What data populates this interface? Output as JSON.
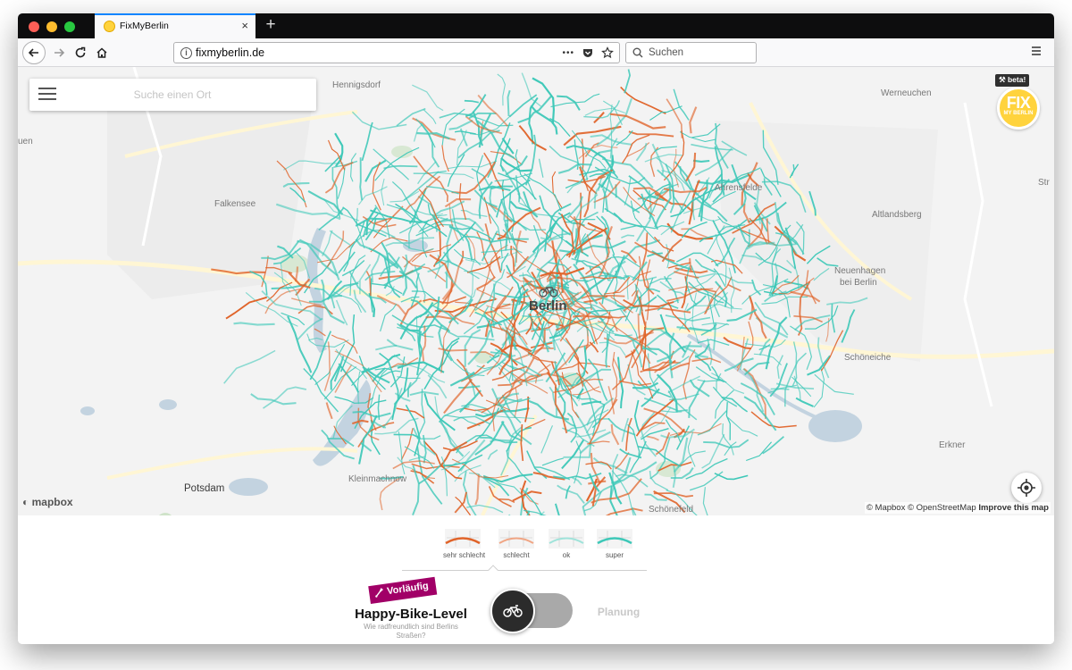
{
  "browser": {
    "tab_title": "FixMyBerlin",
    "new_tab_label": "+",
    "close_label": "×",
    "url": "fixmyberlin.de",
    "search_placeholder": "Suchen",
    "more_label": "•••"
  },
  "app": {
    "search_placeholder": "Suche einen Ort",
    "beta_label": "beta!",
    "logo_text": "FIX",
    "logo_sub": "MY BERLIN"
  },
  "map": {
    "labels": {
      "hennigsdorf": "Hennigsdorf",
      "werneuchen": "Werneuchen",
      "ahrensfelde": "Ahrensfelde",
      "falkensee": "Falkensee",
      "altlandsberg": "Altlandsberg",
      "neuenhagen": "Neuenhagen",
      "neuenhagen_line2": "bei Berlin",
      "berlin": "Berlin",
      "schoeneiche": "Schöneiche",
      "erkner": "Erkner",
      "potsdam": "Potsdam",
      "kleinmachnow": "Kleinmachnow",
      "schoenefeld": "Schönefeld",
      "left_edge": "uen",
      "right_edge": "Str"
    },
    "attribution_mapbox": "© Mapbox",
    "attribution_osm": "© OpenStreetMap",
    "attribution_improve": "Improve this map",
    "mapbox_logo": "mapbox",
    "colors": {
      "good": "#3ec8b8",
      "bad": "#e0642a"
    }
  },
  "legend": {
    "items": [
      {
        "label": "sehr schlecht"
      },
      {
        "label": "schlecht"
      },
      {
        "label": "ok"
      },
      {
        "label": "super"
      }
    ]
  },
  "panel": {
    "badge": "Vorläufig",
    "title": "Happy-Bike-Level",
    "subtitle": "Wie radfreundlich sind Berlins Straßen?",
    "toggle_right_label": "Planung"
  }
}
